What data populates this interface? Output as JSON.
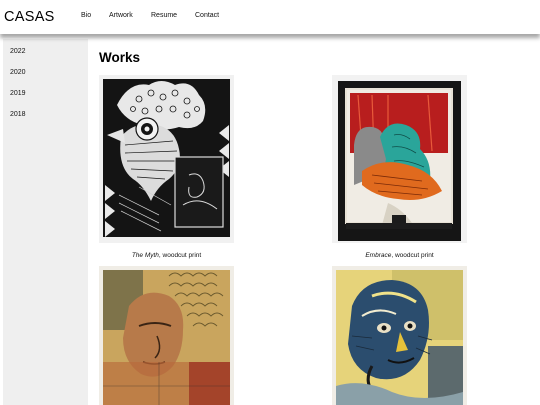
{
  "site": {
    "brand": "CASAS"
  },
  "nav": [
    {
      "label": "Bio"
    },
    {
      "label": "Artwork"
    },
    {
      "label": "Resume"
    },
    {
      "label": "Contact"
    }
  ],
  "sidebar": {
    "years": [
      "2022",
      "2020",
      "2019",
      "2018"
    ]
  },
  "main": {
    "title": "Works",
    "works": [
      {
        "title": "The Myth",
        "medium": ", woodcut print"
      },
      {
        "title": "Embrace",
        "medium": ", woodcut print"
      },
      {
        "title": "",
        "medium": ""
      },
      {
        "title": "",
        "medium": ""
      }
    ]
  },
  "colors": {
    "sidebar_bg": "#efefef",
    "text": "#111111"
  }
}
